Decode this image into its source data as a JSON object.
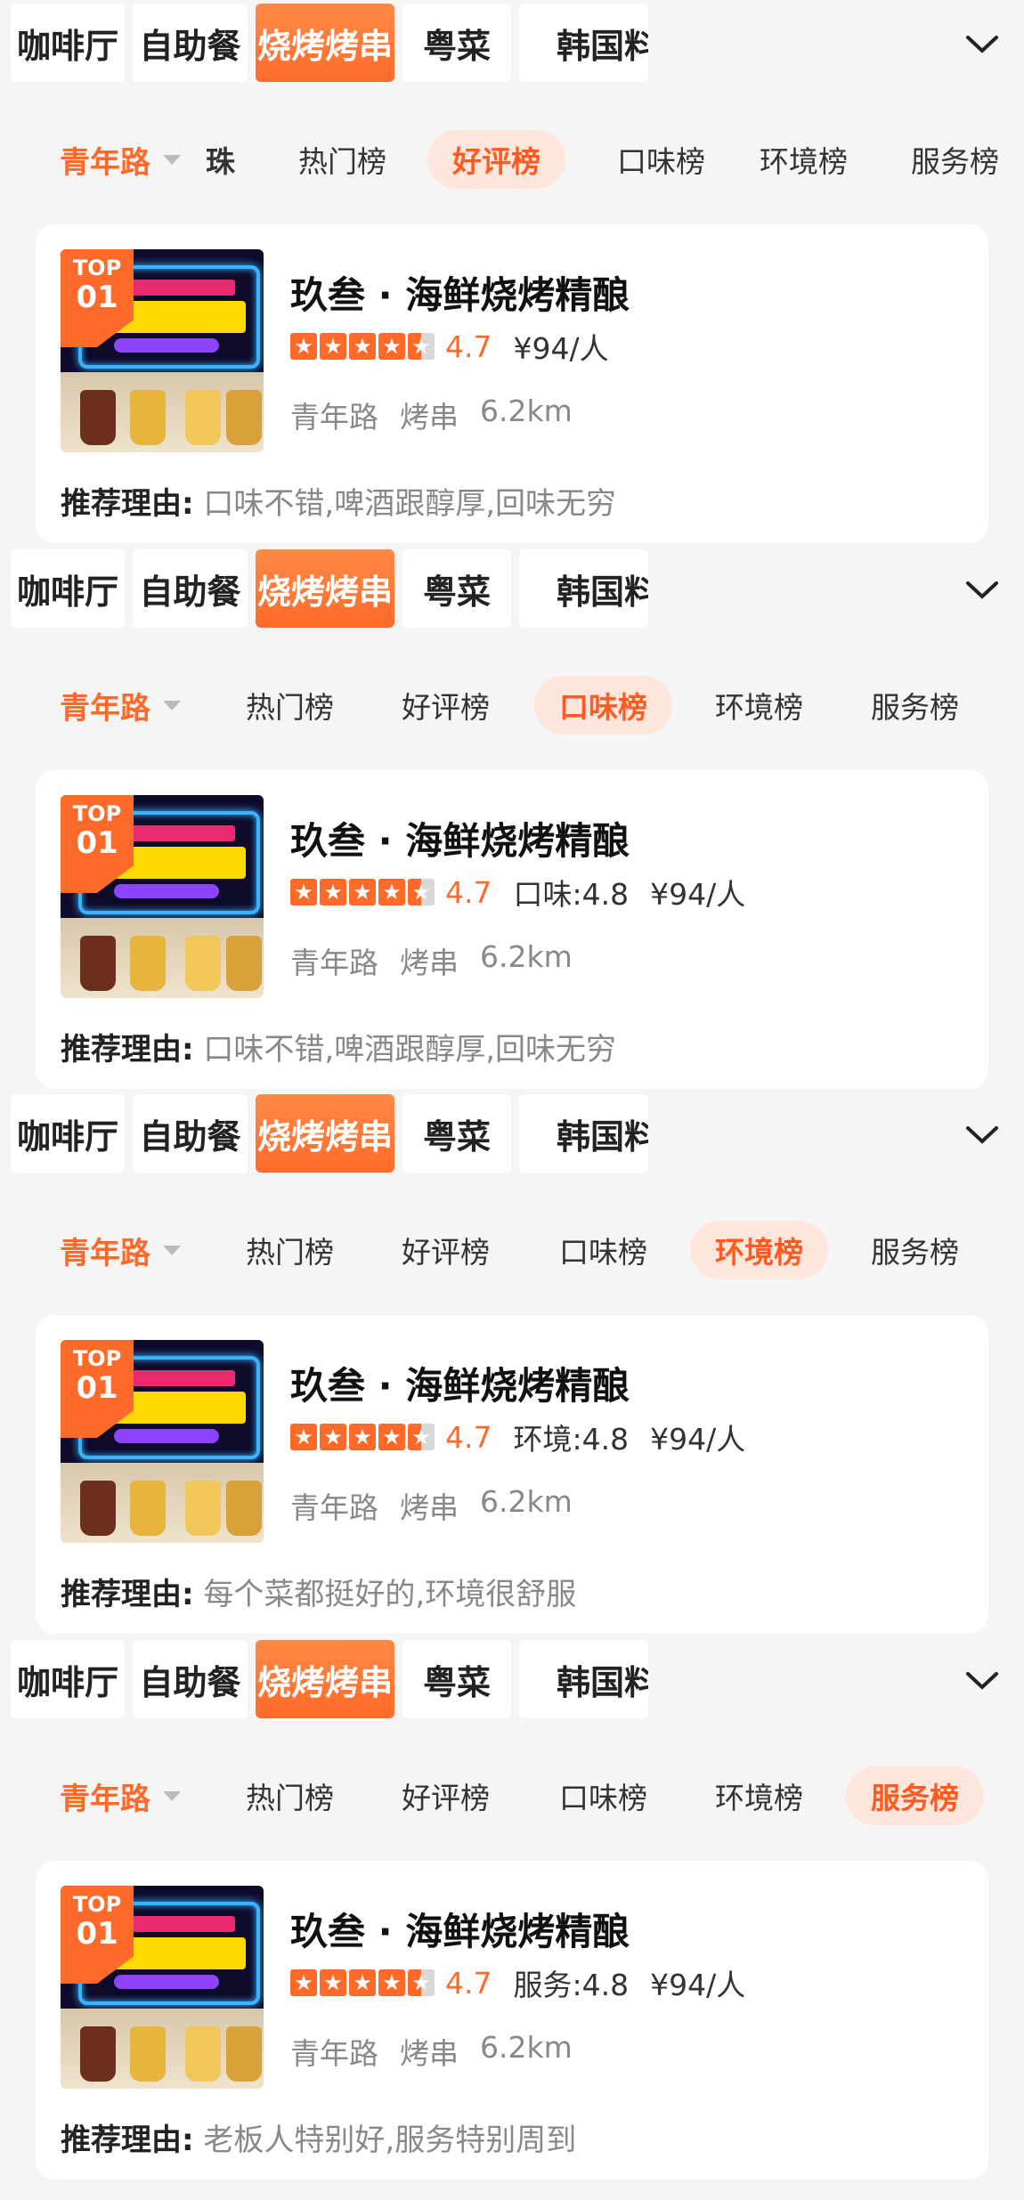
{
  "categories": [
    "咖啡厅",
    "自助餐",
    "烧烤烤串",
    "粤菜",
    "韩国料"
  ],
  "active_category_index": 2,
  "location": "青年路",
  "shop": {
    "name": "玖叁 · 海鲜烧烤精酿",
    "rank": "01",
    "rank_prefix": "TOP",
    "rating": 4.7,
    "rating_text": "4.7",
    "price": "¥94/人",
    "area": "青年路",
    "category": "烤串",
    "distance": "6.2km",
    "reason_label": "推荐理由:"
  },
  "sections": [
    {
      "tabs": [
        "珠",
        "热门榜",
        "好评榜",
        "口味榜",
        "环境榜",
        "服务榜"
      ],
      "active_tab": "好评榜",
      "sub_score": "",
      "reason": "口味不错,啤酒跟醇厚,回味无穷"
    },
    {
      "tabs": [
        "热门榜",
        "好评榜",
        "口味榜",
        "环境榜",
        "服务榜"
      ],
      "active_tab": "口味榜",
      "sub_score": "口味:4.8",
      "reason": "口味不错,啤酒跟醇厚,回味无穷"
    },
    {
      "tabs": [
        "热门榜",
        "好评榜",
        "口味榜",
        "环境榜",
        "服务榜"
      ],
      "active_tab": "环境榜",
      "sub_score": "环境:4.8",
      "reason": "每个菜都挺好的,环境很舒服"
    },
    {
      "tabs": [
        "热门榜",
        "好评榜",
        "口味榜",
        "环境榜",
        "服务榜"
      ],
      "active_tab": "服务榜",
      "sub_score": "服务:4.8",
      "reason": "老板人特别好,服务特别周到"
    }
  ],
  "icons": {
    "expand": "chevron-down-icon",
    "location_dropdown": "caret-down-icon",
    "star": "star-icon"
  },
  "colors": {
    "accent": "#ff6a2a",
    "tab_active_bg": "#ffe6dc",
    "page_bg": "#f5f5f5"
  }
}
